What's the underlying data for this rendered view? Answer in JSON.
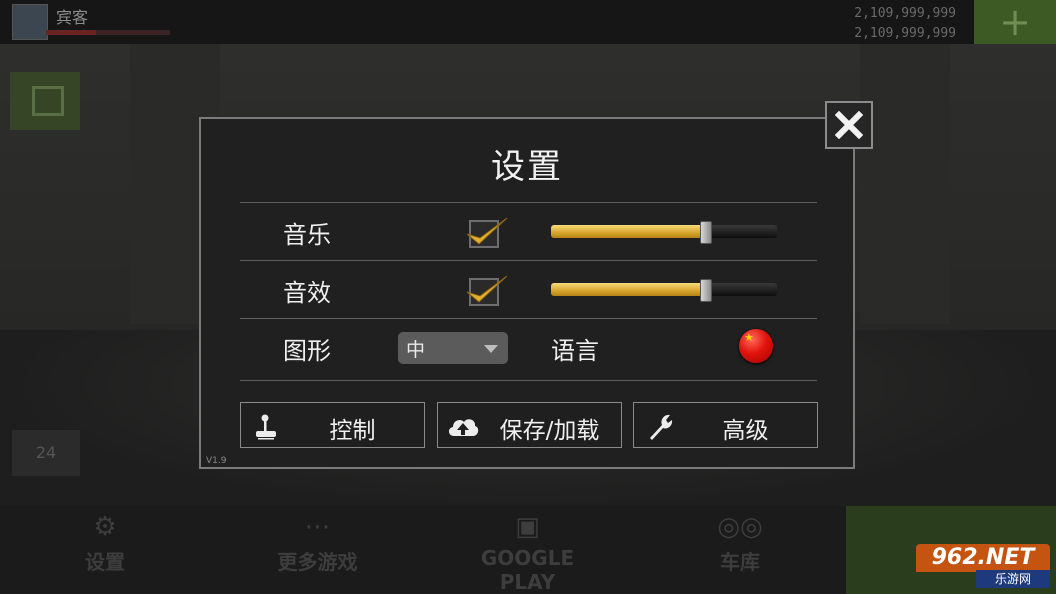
{
  "hud": {
    "player_name": "宾客",
    "currency_1": "2,109,999,999",
    "currency_2": "2,109,999,999",
    "add_label": "+",
    "timer_value": "24"
  },
  "bottom_nav": [
    {
      "label": "设置",
      "icon": "gear-icon"
    },
    {
      "label": "更多游戏",
      "icon": "chat-dots-icon"
    },
    {
      "label": "GOOGLE PLAY",
      "icon": "gamepad-icon"
    },
    {
      "label": "车库",
      "icon": "motorcycle-icon"
    }
  ],
  "settings": {
    "title": "设置",
    "music": {
      "label": "音乐",
      "enabled": true,
      "level": 0.68
    },
    "sound": {
      "label": "音效",
      "enabled": true,
      "level": 0.68
    },
    "graphics": {
      "label": "图形",
      "value": "中"
    },
    "language": {
      "label": "语言",
      "flag": "china-flag-icon"
    },
    "buttons": [
      {
        "label": "控制",
        "icon": "joystick-icon"
      },
      {
        "label": "保存/加载",
        "icon": "cloud-upload-icon"
      },
      {
        "label": "高级",
        "icon": "wrench-icon"
      }
    ],
    "version": "V1.9",
    "close_icon": "close-icon"
  },
  "watermark": {
    "brand": "962.NET",
    "sub": "乐游网"
  },
  "colors": {
    "modal_bg": "#202020",
    "modal_border": "#7b7b7b",
    "slider_fill": "#d7a52c",
    "check": "#e2b02c"
  }
}
